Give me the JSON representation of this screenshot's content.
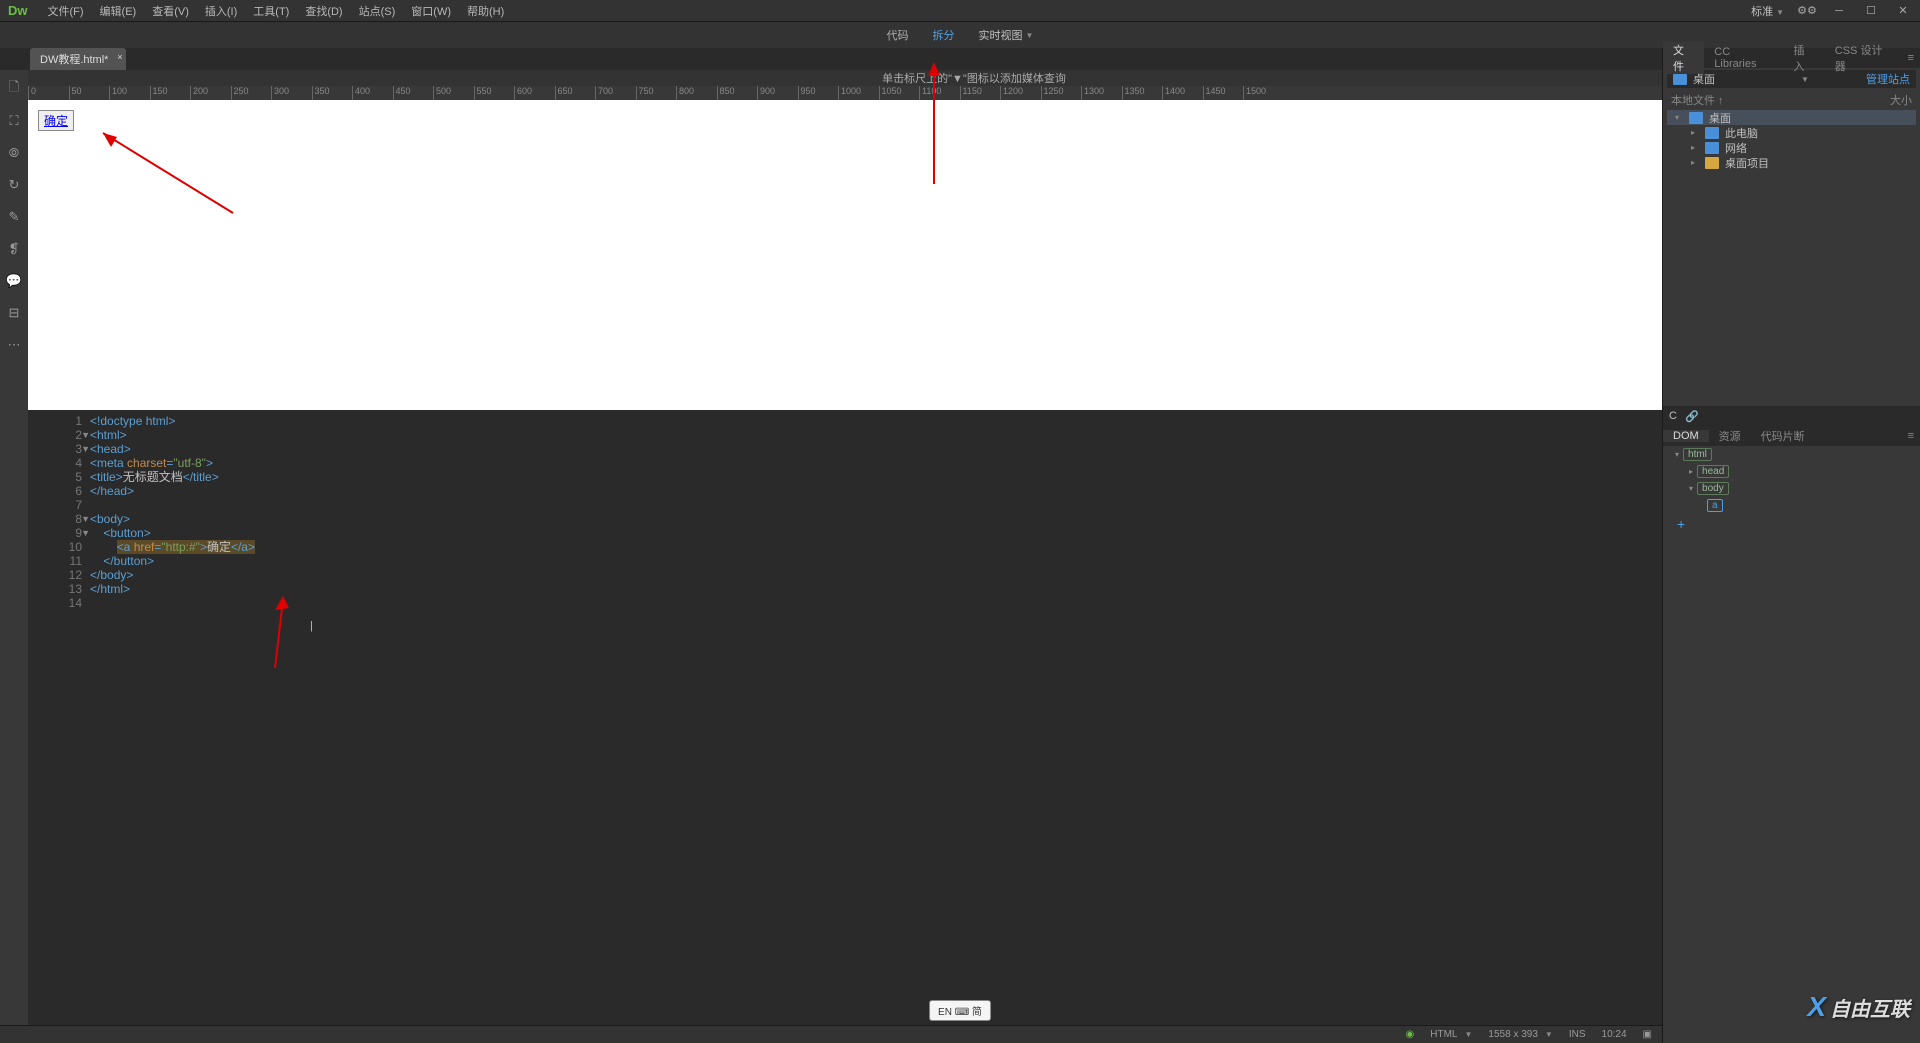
{
  "app": {
    "logo": "Dw",
    "workspace": "标准"
  },
  "menu": [
    "文件(F)",
    "编辑(E)",
    "查看(V)",
    "插入(I)",
    "工具(T)",
    "查找(D)",
    "站点(S)",
    "窗口(W)",
    "帮助(H)"
  ],
  "views": {
    "code": "代码",
    "split": "拆分",
    "live": "实时视图"
  },
  "tab": {
    "title": "DW教程.html*"
  },
  "ruler_hint": "单击标尺上的\"▼\"图标以添加媒体查询",
  "ruler_marks": [
    0,
    50,
    100,
    150,
    200,
    250,
    300,
    350,
    400,
    450,
    500,
    550,
    600,
    650,
    700,
    750,
    800,
    850,
    900,
    950,
    1000,
    1050,
    1100,
    1150,
    1200,
    1250,
    1300,
    1350,
    1400,
    1450,
    1500
  ],
  "design_button": {
    "label": "确定"
  },
  "code": {
    "lines": [
      {
        "n": 1,
        "fold": "",
        "parts": [
          {
            "c": "tag",
            "t": "<!doctype html>"
          }
        ]
      },
      {
        "n": 2,
        "fold": "▼",
        "parts": [
          {
            "c": "tag",
            "t": "<html>"
          }
        ]
      },
      {
        "n": 3,
        "fold": "▼",
        "parts": [
          {
            "c": "tag",
            "t": "<head>"
          }
        ]
      },
      {
        "n": 4,
        "fold": "",
        "parts": [
          {
            "c": "tag",
            "t": "<meta "
          },
          {
            "c": "attr",
            "t": "charset"
          },
          {
            "c": "tag",
            "t": "="
          },
          {
            "c": "str",
            "t": "\"utf-8\""
          },
          {
            "c": "tag",
            "t": ">"
          }
        ]
      },
      {
        "n": 5,
        "fold": "",
        "parts": [
          {
            "c": "tag",
            "t": "<title>"
          },
          {
            "c": "txt",
            "t": "无标题文档"
          },
          {
            "c": "tag",
            "t": "</title>"
          }
        ]
      },
      {
        "n": 6,
        "fold": "",
        "parts": [
          {
            "c": "tag",
            "t": "</head>"
          }
        ]
      },
      {
        "n": 7,
        "fold": "",
        "parts": []
      },
      {
        "n": 8,
        "fold": "▼",
        "parts": [
          {
            "c": "tag",
            "t": "<body>"
          }
        ]
      },
      {
        "n": 9,
        "fold": "▼",
        "parts": [
          {
            "c": "txt",
            "t": "    "
          },
          {
            "c": "tag",
            "t": "<button>"
          }
        ]
      },
      {
        "n": 10,
        "fold": "",
        "parts": [
          {
            "c": "txt",
            "t": "        "
          },
          {
            "c": "hl",
            "t": "",
            "wrap": true,
            "inner": [
              {
                "c": "tag",
                "t": "<a "
              },
              {
                "c": "attr",
                "t": "href"
              },
              {
                "c": "tag",
                "t": "="
              },
              {
                "c": "str",
                "t": "\"http:#\""
              },
              {
                "c": "tag",
                "t": ">"
              },
              {
                "c": "txt",
                "t": "确定"
              },
              {
                "c": "tag",
                "t": "</a>"
              }
            ]
          }
        ]
      },
      {
        "n": 11,
        "fold": "",
        "parts": [
          {
            "c": "txt",
            "t": "    "
          },
          {
            "c": "tag",
            "t": "</button>"
          }
        ]
      },
      {
        "n": 12,
        "fold": "",
        "parts": [
          {
            "c": "tag",
            "t": "</body>"
          }
        ]
      },
      {
        "n": 13,
        "fold": "",
        "parts": [
          {
            "c": "tag",
            "t": "</html>"
          }
        ]
      },
      {
        "n": 14,
        "fold": "",
        "parts": []
      }
    ]
  },
  "ime": "EN ⌨ 简",
  "status": {
    "lang": "HTML",
    "dims": "1558 x 393",
    "ins": "INS",
    "pos": "10:24"
  },
  "panel": {
    "tabs": [
      "文件",
      "CC Libraries",
      "插入",
      "CSS 设计器"
    ],
    "active_tab": 0,
    "dropdown": "桌面",
    "manage_link": "管理站点",
    "header": {
      "col1": "本地文件 ↑",
      "col2": "大小"
    },
    "tree": [
      {
        "indent": 0,
        "chev": "▾",
        "icon": "folder-blue",
        "label": "桌面",
        "sel": true
      },
      {
        "indent": 1,
        "chev": "▸",
        "icon": "icon-pc",
        "label": "此电脑"
      },
      {
        "indent": 1,
        "chev": "▸",
        "icon": "icon-net",
        "label": "网络"
      },
      {
        "indent": 1,
        "chev": "▸",
        "icon": "folder-yellow",
        "label": "桌面项目"
      }
    ],
    "dom_tabs": [
      "DOM",
      "资源",
      "代码片断"
    ],
    "dom_tree": [
      {
        "indent": 0,
        "chev": "▾",
        "tag": "html"
      },
      {
        "indent": 1,
        "chev": "▸",
        "tag": "head"
      },
      {
        "indent": 1,
        "chev": "▾",
        "tag": "body"
      },
      {
        "indent": 2,
        "chev": "",
        "tag": "a",
        "sel": true
      }
    ]
  },
  "watermark": "自由互联"
}
